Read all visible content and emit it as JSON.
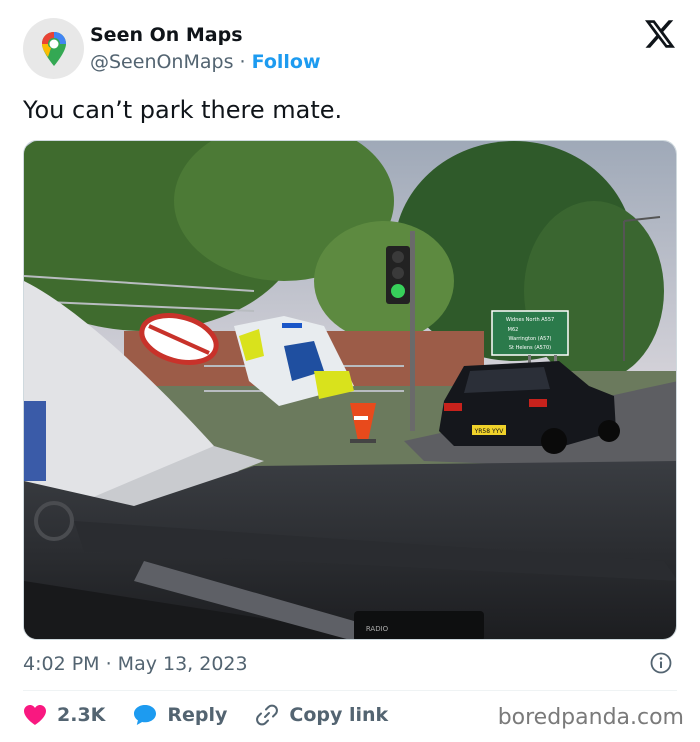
{
  "author": {
    "display_name": "Seen On Maps",
    "handle": "@SeenOnMaps",
    "separator": "·",
    "follow_label": "Follow",
    "avatar_icon": "google-maps-pin-icon"
  },
  "platform_icon": "x-logo-icon",
  "tweet": {
    "text": "You can’t park there mate."
  },
  "photo": {
    "road_sign_lines": [
      "Widnes North A557",
      "M62",
      "Warrington (A57)",
      "St Helens (A570)"
    ],
    "plate_text": "YR58 YYV",
    "radio_label": "RADIO"
  },
  "meta": {
    "timestamp": "4:02 PM · May 13, 2023",
    "info_icon": "info-icon"
  },
  "engagement": {
    "likes": "2.3K",
    "reply_label": "Reply",
    "copy_link_label": "Copy link"
  },
  "watermark": "boredpanda.com",
  "colors": {
    "follow_blue": "#1d9bf0",
    "like_pink": "#f91880",
    "muted_gray": "#536471"
  }
}
